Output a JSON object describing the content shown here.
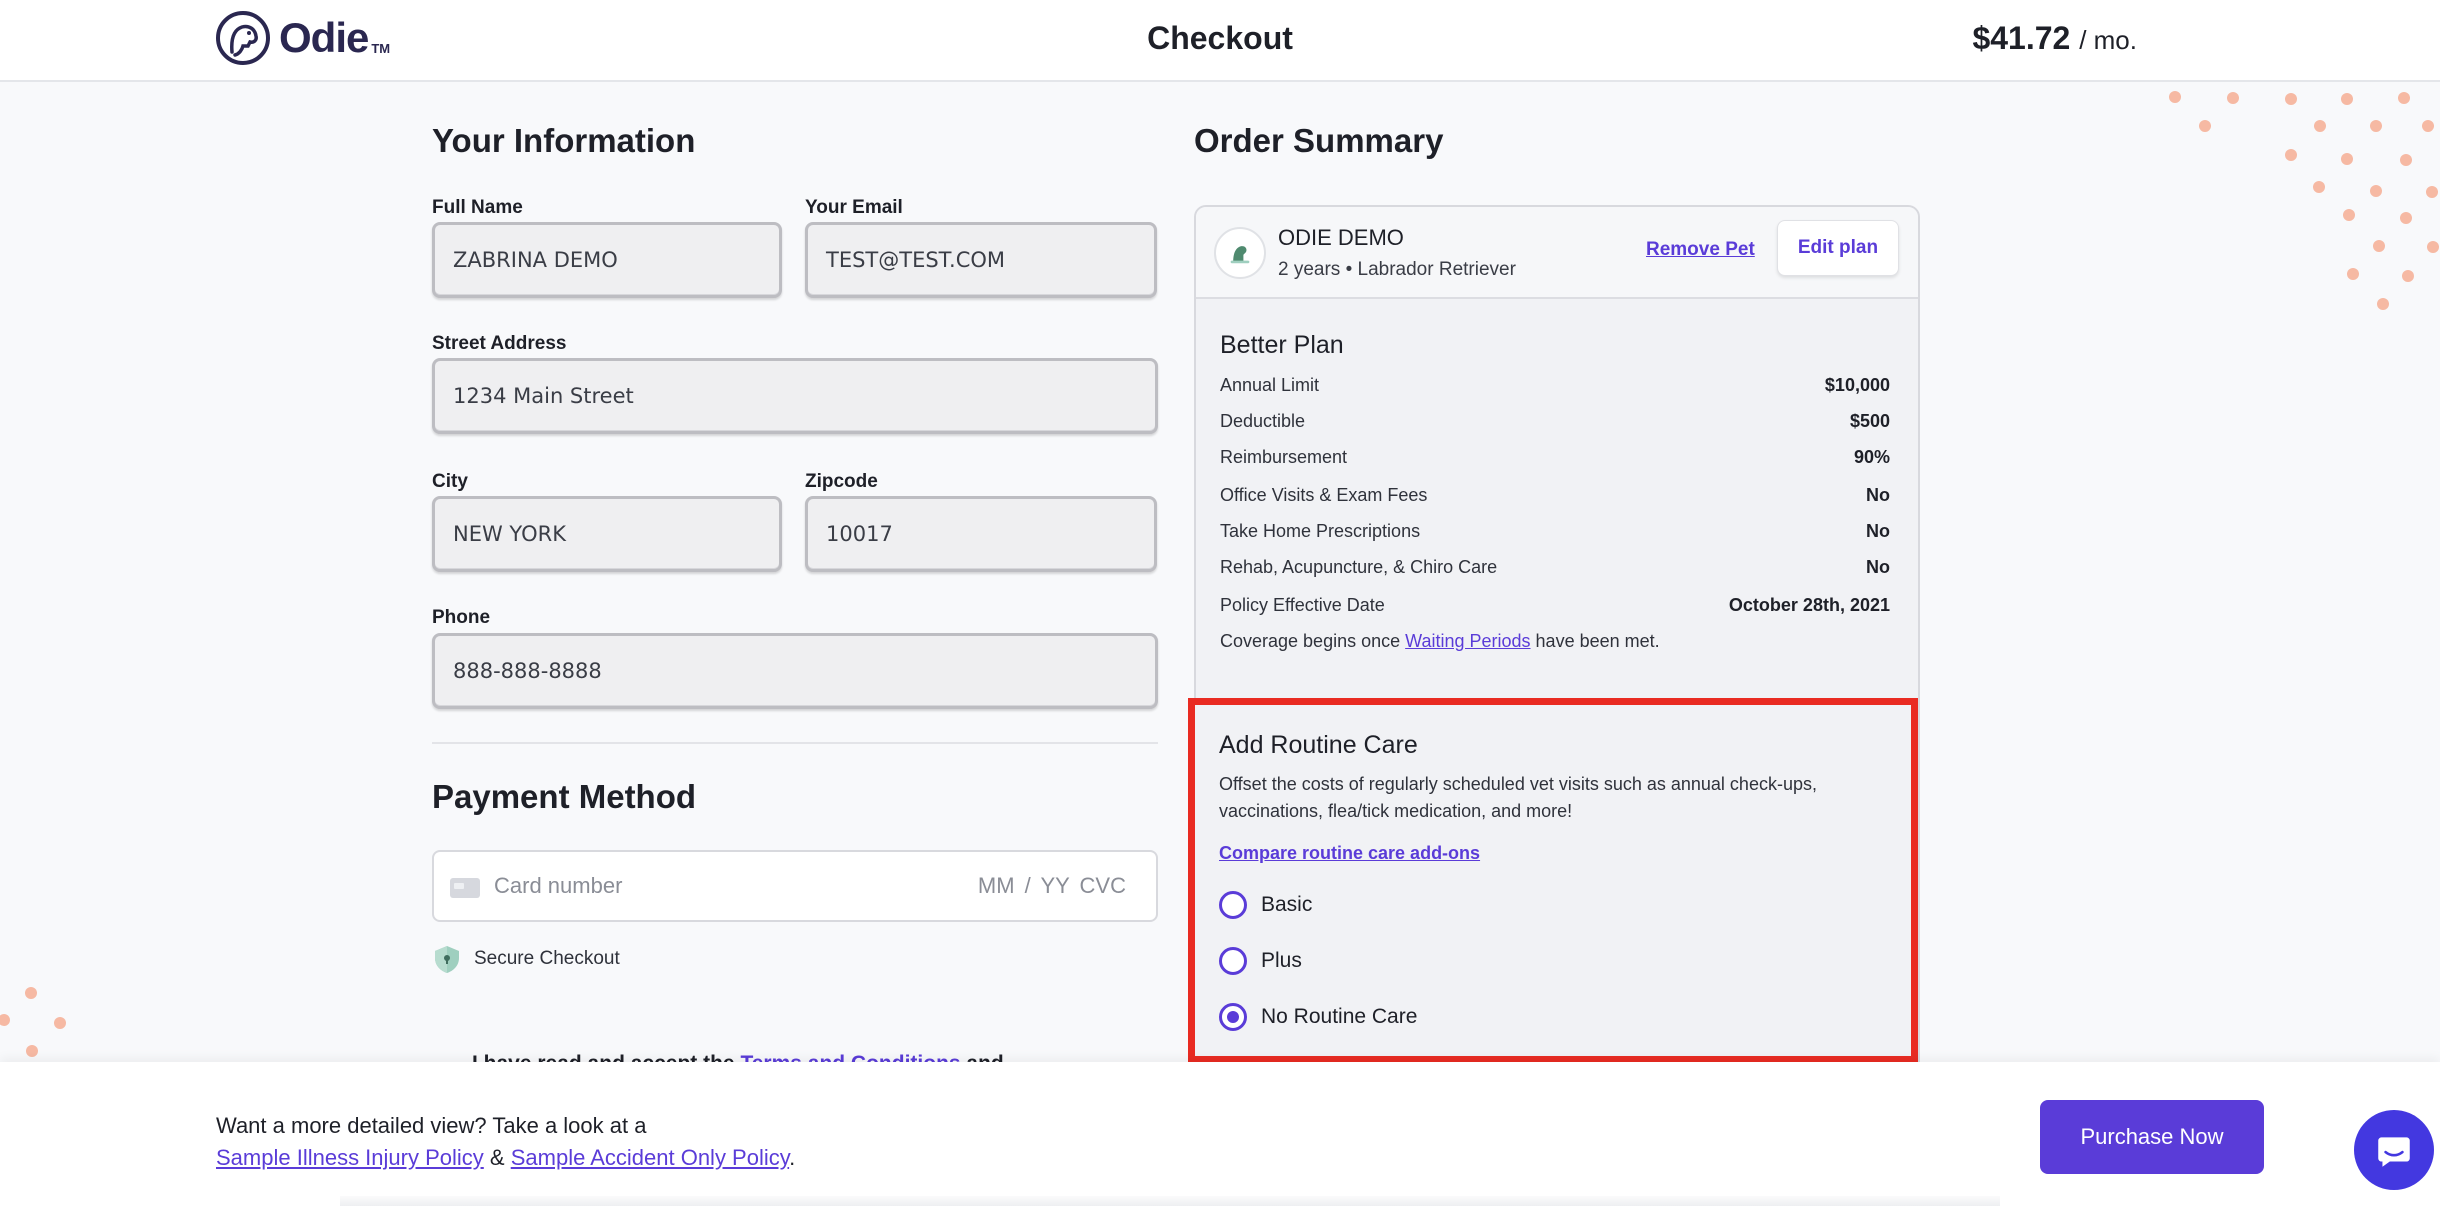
{
  "header": {
    "logo_text": "Odie",
    "logo_tm": "TM",
    "title": "Checkout",
    "price_amount": "$41.72",
    "price_period": "/ mo."
  },
  "your_information": {
    "title": "Your Information",
    "full_name_label": "Full Name",
    "full_name_value": "ZABRINA DEMO",
    "email_label": "Your Email",
    "email_value": "TEST@TEST.COM",
    "street_label": "Street Address",
    "street_value": "1234 Main Street",
    "city_label": "City",
    "city_value": "NEW YORK",
    "zip_label": "Zipcode",
    "zip_value": "10017",
    "phone_label": "Phone",
    "phone_value": "888-888-8888"
  },
  "payment": {
    "title": "Payment Method",
    "card_placeholder": "Card number",
    "exp_cvc_placeholder": "MM / YY  CVC",
    "secure_text": "Secure Checkout",
    "terms_prefix": "I have read and accept the",
    "terms_link": "Terms and Conditions",
    "terms_suffix": "and"
  },
  "order_summary": {
    "title": "Order Summary",
    "pet_name": "ODIE DEMO",
    "pet_details": "2 years • Labrador Retriever",
    "remove_pet": "Remove Pet",
    "edit_plan": "Edit plan",
    "plan_title": "Better Plan",
    "plan_rows": [
      {
        "label": "Annual Limit",
        "value": "$10,000"
      },
      {
        "label": "Deductible",
        "value": "$500"
      },
      {
        "label": "Reimbursement",
        "value": "90%"
      },
      {
        "label": "Office Visits & Exam Fees",
        "value": "No"
      },
      {
        "label": "Take Home Prescriptions",
        "value": "No"
      },
      {
        "label": "Rehab, Acupuncture, & Chiro Care",
        "value": "No"
      },
      {
        "label": "Policy Effective Date",
        "value": "October 28th, 2021"
      }
    ],
    "coverage_prefix": "Coverage begins once",
    "coverage_link": "Waiting Periods",
    "coverage_suffix": "have been met."
  },
  "routine_care": {
    "title": "Add Routine Care",
    "description": "Offset the costs of regularly scheduled vet visits such as annual check-ups, vaccinations, flea/tick medication, and more!",
    "compare_link": "Compare routine care add-ons",
    "options": [
      {
        "label": "Basic",
        "checked": false
      },
      {
        "label": "Plus",
        "checked": false
      },
      {
        "label": "No Routine Care",
        "checked": true
      }
    ]
  },
  "footer": {
    "text": "Want a more detailed view? Take a look at a",
    "illness_link": "Sample Illness Injury Policy",
    "amp": "&",
    "accident_link": "Sample Accident Only Policy",
    "period": ".",
    "purchase_button": "Purchase Now"
  },
  "colors": {
    "brand_purple": "#5a3cd8",
    "highlight_red": "#e92b22",
    "dot_peach": "#f6b9a3",
    "chat_blue": "#4338e0"
  },
  "icons": {
    "logo": "dog-logo-icon",
    "card": "credit-card-icon",
    "secure": "shield-icon",
    "pet": "dog-icon",
    "chat": "chat-bubble-icon"
  }
}
